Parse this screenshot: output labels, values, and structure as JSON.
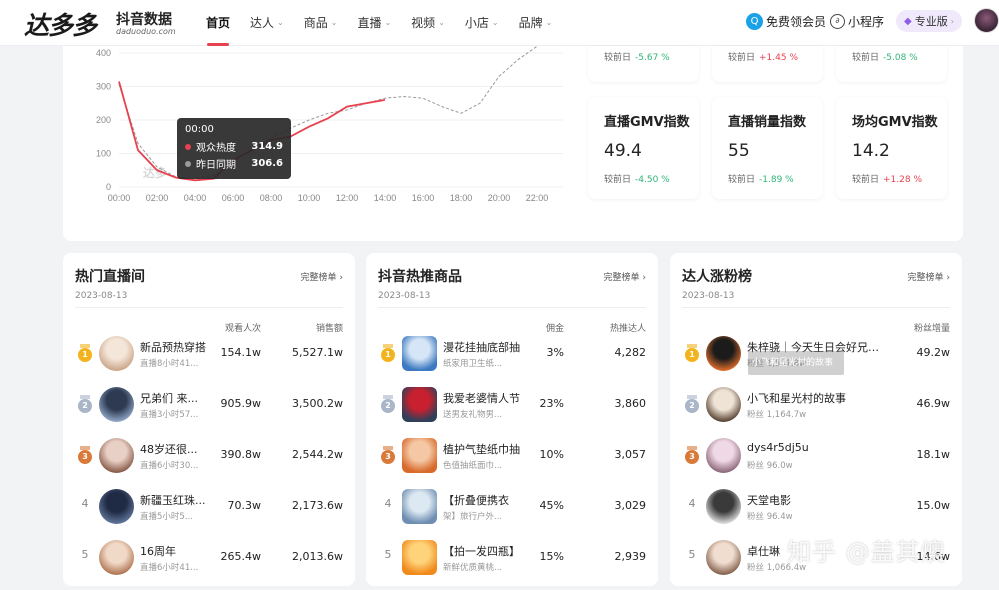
{
  "header": {
    "logo_text": "达多多",
    "logo_sub": "抖音数据",
    "logo_url": "daduoduo.com",
    "nav": [
      {
        "label": "首页",
        "active": true,
        "caret": false
      },
      {
        "label": "达人",
        "active": false,
        "caret": true
      },
      {
        "label": "商品",
        "active": false,
        "caret": true
      },
      {
        "label": "直播",
        "active": false,
        "caret": true
      },
      {
        "label": "视频",
        "active": false,
        "caret": true
      },
      {
        "label": "小店",
        "active": false,
        "caret": true
      },
      {
        "label": "品牌",
        "active": false,
        "caret": true
      }
    ],
    "member_label": "免费领会员",
    "miniprogram_label": "小程序",
    "pro_label": "专业版"
  },
  "chart_data": {
    "type": "line",
    "y_ticks": [
      "0",
      "100",
      "200",
      "300",
      "400"
    ],
    "x_ticks": [
      "00:00",
      "02:00",
      "04:00",
      "06:00",
      "08:00",
      "10:00",
      "12:00",
      "14:00",
      "16:00",
      "18:00",
      "20:00",
      "22:00"
    ],
    "ylim": [
      0,
      400
    ],
    "series": [
      {
        "name": "观众热度",
        "color": "#e8414f",
        "x": [
          0,
          1,
          2,
          3,
          4,
          5,
          6,
          7,
          8,
          9,
          10,
          11,
          12,
          13,
          14
        ],
        "values": [
          314.9,
          110,
          50,
          28,
          20,
          25,
          80,
          110,
          140,
          150,
          180,
          205,
          240,
          250,
          260
        ]
      },
      {
        "name": "昨日同期",
        "color": "#9a9a9a",
        "x": [
          0,
          1,
          2,
          3,
          4,
          5,
          6,
          7,
          8,
          9,
          10,
          11,
          12,
          13,
          14,
          15,
          16,
          17,
          18,
          19,
          20,
          21,
          22
        ],
        "values": [
          306.6,
          130,
          60,
          30,
          25,
          35,
          75,
          115,
          145,
          175,
          200,
          220,
          230,
          250,
          265,
          270,
          265,
          240,
          220,
          250,
          330,
          380,
          420
        ]
      }
    ],
    "watermark": "达多"
  },
  "tooltip": {
    "time": "00:00",
    "rows": [
      {
        "name": "观众热度",
        "value": "314.9",
        "color": "#e8414f"
      },
      {
        "name": "昨日同期",
        "value": "306.6",
        "color": "#9a9a9a"
      }
    ]
  },
  "metrics_top": [
    {
      "cmp_label": "较前日",
      "cmp_value": "-5.67 %",
      "dir": "down"
    },
    {
      "cmp_label": "较前日",
      "cmp_value": "+1.45 %",
      "dir": "up"
    },
    {
      "cmp_label": "较前日",
      "cmp_value": "-5.08 %",
      "dir": "down"
    }
  ],
  "metrics": [
    {
      "title": "直播GMV指数",
      "value": "49.4",
      "cmp_label": "较前日",
      "cmp_value": "-4.50 %",
      "dir": "down"
    },
    {
      "title": "直播销量指数",
      "value": "55",
      "cmp_label": "较前日",
      "cmp_value": "-1.89 %",
      "dir": "down"
    },
    {
      "title": "场均GMV指数",
      "value": "14.2",
      "cmp_label": "较前日",
      "cmp_value": "+1.28 %",
      "dir": "up"
    }
  ],
  "panels": [
    {
      "title": "热门直播间",
      "more": "完整榜单",
      "date": "2023-08-13",
      "col1": "观看人次",
      "col2": "销售额",
      "rows": [
        {
          "rank": "1",
          "name": "新品预热穿搭",
          "sub": "直播8小时41...",
          "c1": "154.1w",
          "c2": "5,527.1w"
        },
        {
          "rank": "2",
          "name": "兄弟们 来...",
          "sub": "直播3小时57...",
          "c1": "905.9w",
          "c2": "3,500.2w"
        },
        {
          "rank": "3",
          "name": "48岁还很...",
          "sub": "直播6小时30...",
          "c1": "390.8w",
          "c2": "2,544.2w"
        },
        {
          "rank": "4",
          "name": "新疆玉红珠...",
          "sub": "直播5小时5...",
          "c1": "70.3w",
          "c2": "2,173.6w"
        },
        {
          "rank": "5",
          "name": "16周年",
          "sub": "直播6小时41...",
          "c1": "265.4w",
          "c2": "2,013.6w"
        }
      ]
    },
    {
      "title": "抖音热推商品",
      "more": "完整榜单",
      "date": "2023-08-13",
      "col1": "佣金",
      "col2": "热推达人",
      "rows": [
        {
          "rank": "1",
          "name": "漫花挂抽底部抽",
          "sub": "纸家用卫生纸...",
          "c1": "3%",
          "c2": "4,282"
        },
        {
          "rank": "2",
          "name": "我爱老婆情人节",
          "sub": "送男友礼物男...",
          "c1": "23%",
          "c2": "3,860"
        },
        {
          "rank": "3",
          "name": "植护气垫纸巾抽",
          "sub": "色值抽纸面巾...",
          "c1": "10%",
          "c2": "3,057"
        },
        {
          "rank": "4",
          "name": "【折叠便携衣",
          "sub": "架】旅行户外...",
          "c1": "45%",
          "c2": "3,029"
        },
        {
          "rank": "5",
          "name": "【拍一发四瓶】",
          "sub": "新鲜优质黄桃...",
          "c1": "15%",
          "c2": "2,939"
        }
      ]
    },
    {
      "title": "达人涨粉榜",
      "more": "完整榜单",
      "date": "2023-08-13",
      "col1": "",
      "col2": "粉丝增量",
      "rows": [
        {
          "rank": "1",
          "name": "朱梓骁｜今天生日会好兄弟...",
          "sub": "粉丝 1,551.8w",
          "c1": "",
          "c2": "49.2w"
        },
        {
          "rank": "2",
          "name": "小飞和星光村的故事",
          "sub": "粉丝 1,164.7w",
          "c1": "",
          "c2": "46.9w"
        },
        {
          "rank": "3",
          "name": "dys4r5dj5u",
          "sub": "粉丝 96.0w",
          "c1": "",
          "c2": "18.1w"
        },
        {
          "rank": "4",
          "name": "天堂电影",
          "sub": "粉丝 96.4w",
          "c1": "",
          "c2": "15.0w"
        },
        {
          "rank": "5",
          "name": "卓仕琳",
          "sub": "粉丝 1,066.4w",
          "c1": "",
          "c2": "14.6w"
        }
      ]
    }
  ],
  "popup_label": "小飞和星光村的故事",
  "watermark": "知乎 @盖其燠",
  "colors": {
    "accent": "#e8414f",
    "gold": "#f2b31c",
    "silver": "#a9b6c8",
    "bronze": "#d97a3a"
  }
}
